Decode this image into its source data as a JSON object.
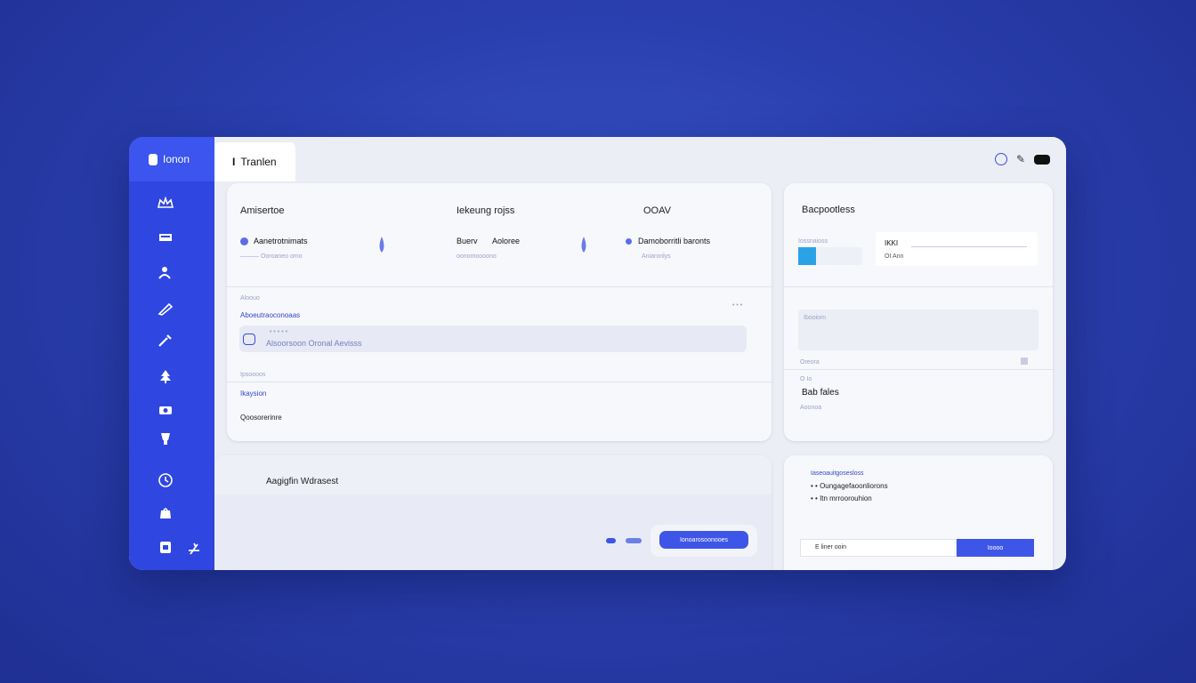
{
  "app": {
    "brand": "Ionon",
    "active_tab": "Tranlen",
    "tab_icon": "I"
  },
  "sidebar": {
    "icons": [
      "crown-icon",
      "card-icon",
      "user-icon",
      "pen-icon",
      "tool-icon",
      "tree-icon",
      "camera-icon",
      "cup-icon",
      "clock-icon",
      "bag-icon",
      "box-icon",
      "settings-icon"
    ]
  },
  "topbar": {
    "icons": [
      "circle-icon",
      "pen-icon",
      "pill-icon"
    ]
  },
  "main_card": {
    "col1_title": "Amisertoe",
    "col2_title": "Iekeung rojss",
    "col3_title": "OOAV",
    "col1_item": "Aanetrotnimats",
    "col1_sub": "——— Ooroaneo omo",
    "col2_item_a": "Buerv",
    "col2_item_b": "Aoloree",
    "col2_sub": "oonomoooono",
    "col3_item": "Damoborritli baronts",
    "col3_sub": "Aniaronlys",
    "section_label": "Aloouo",
    "section_link": "Aboeutraoconoaas",
    "dots": "• • •",
    "input_dots": "• • • • •",
    "input_text": "Alsoorsoon Oronal Aevisss",
    "sub_label": "Ipsoooos",
    "row1": "Ikaysion",
    "row2": "Qoosorerinre"
  },
  "right_card": {
    "title": "Bacpootless",
    "small_label": "Iossnaioss",
    "field_label": "IKKI",
    "field_sub": "OI Ann",
    "input_label": "Ibooiom",
    "row_label": "Oreora",
    "row2_label": "O Io",
    "value_label": "Bab fales",
    "value_sub": "Aoonoa",
    "accent": "#2aa3e6"
  },
  "bottom_card": {
    "title": "Aagigfin Wdrasest",
    "button_label": "Ionoarosoonooes"
  },
  "bottom_right_card": {
    "header": "Iaseoauitgosesloss",
    "bullet1": "Oungagefaoonliorons",
    "bullet2": "Itn mrroorouhion",
    "input_text": "E liner ooin",
    "button_label": "Ioooo"
  }
}
